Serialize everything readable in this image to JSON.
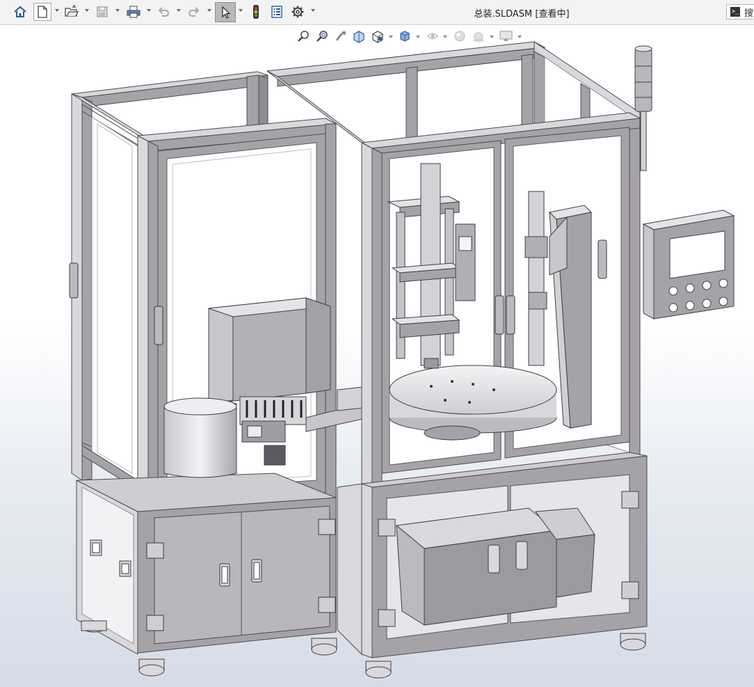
{
  "window": {
    "title": "总装.SLDASM [查看中]"
  },
  "toolbar": {
    "buttons": [
      {
        "icon": "home-icon",
        "name": "home-button"
      },
      {
        "icon": "new-document-icon",
        "name": "new-button"
      },
      {
        "icon": "open-folder-icon",
        "name": "open-button"
      },
      {
        "icon": "save-icon",
        "name": "save-button"
      },
      {
        "icon": "print-icon",
        "name": "print-button"
      },
      {
        "icon": "undo-icon",
        "name": "undo-button"
      },
      {
        "icon": "redo-icon",
        "name": "redo-button"
      },
      {
        "icon": "select-pointer-icon",
        "name": "select-button"
      },
      {
        "icon": "traffic-light-icon",
        "name": "rebuild-button"
      },
      {
        "icon": "file-properties-icon",
        "name": "file-properties-button"
      },
      {
        "icon": "gear-icon",
        "name": "options-button"
      }
    ],
    "search_label": "搜"
  },
  "heads_up_toolbar": {
    "buttons": [
      {
        "icon": "zoom-to-fit-icon"
      },
      {
        "icon": "zoom-to-area-icon"
      },
      {
        "icon": "previous-view-icon"
      },
      {
        "icon": "section-view-icon"
      },
      {
        "icon": "view-orientation-icon"
      },
      {
        "icon": "display-style-icon"
      },
      {
        "icon": "hide-show-items-icon"
      },
      {
        "icon": "edit-appearance-icon"
      },
      {
        "icon": "apply-scene-icon"
      },
      {
        "icon": "view-settings-icon"
      }
    ]
  },
  "colors": {
    "toolbar_bg": "#f3f3f3",
    "frame": "#a6a3a8",
    "frame_light": "#d9d8dc",
    "frame_dark": "#7e7b82",
    "glass": "#ffffff",
    "accent_red": "#c9302c",
    "traffic_green": "#3a9d3a"
  }
}
